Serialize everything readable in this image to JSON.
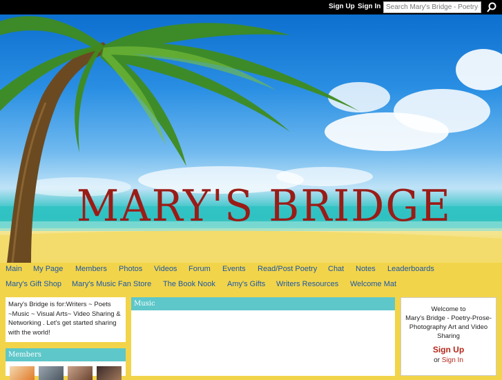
{
  "topbar": {
    "signup_label": "Sign Up",
    "signin_label": "Sign In",
    "search_placeholder": "Search Mary's Bridge - Poetry-Prose-",
    "search_icon": "search-icon"
  },
  "banner": {
    "title": "MARY'S BRIDGE"
  },
  "nav": {
    "row1": [
      "Main",
      "My Page",
      "Members",
      "Photos",
      "Videos",
      "Forum",
      "Events",
      "Read/Post Poetry",
      "Chat",
      "Notes",
      "Leaderboards"
    ],
    "row2": [
      "Mary's Gift Shop",
      "Mary's Music Fan Store",
      "The Book Nook",
      "Amy's Gifts",
      "Writers Resources",
      "Welcome Mat"
    ]
  },
  "intro": {
    "text": "Mary's Bridge is for:Writers ~ Poets ~Music ~ Visual Arts~ Video Sharing & Networking . Let's get started sharing with the world!"
  },
  "members": {
    "title": "Members"
  },
  "music": {
    "title": "Music"
  },
  "welcome": {
    "line1": "Welcome to",
    "line2": "Mary's Bridge - Poetry-Prose-Photography Art and Video Sharing",
    "signup_label": "Sign Up",
    "or_text": "or",
    "signin_label": "Sign In"
  },
  "colors": {
    "accent_teal": "#5ec7c9",
    "nav_link": "#1b56a6",
    "title_red": "#9a1c17",
    "background_yellow": "#f2d44a"
  }
}
